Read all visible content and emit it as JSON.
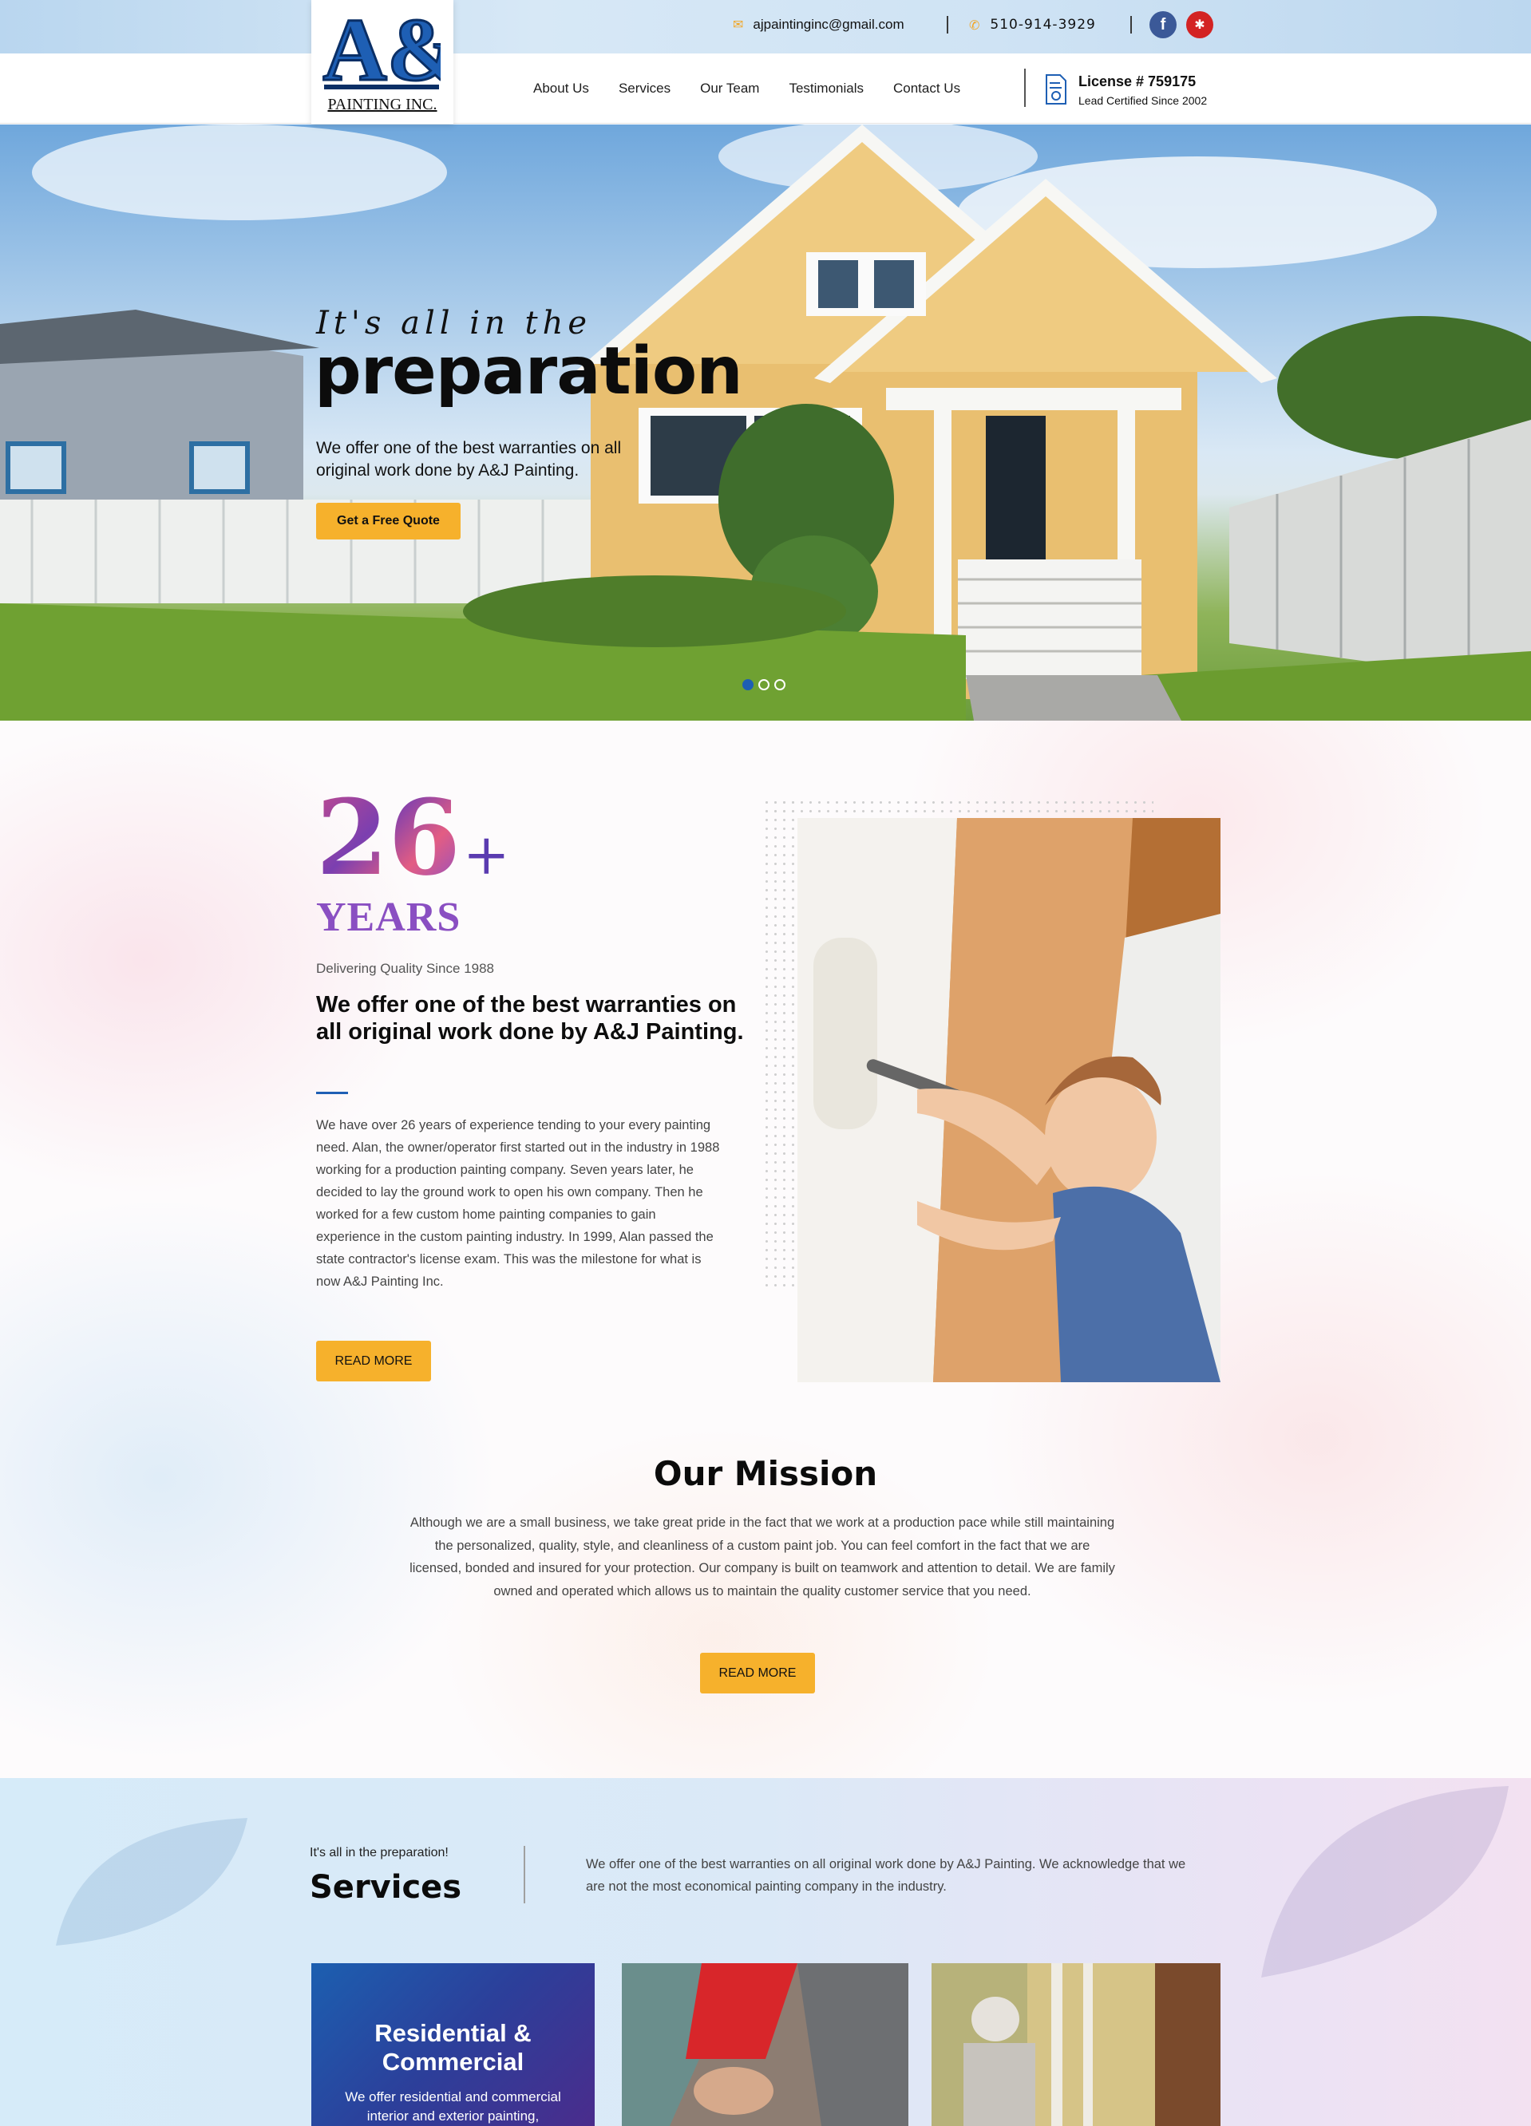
{
  "topbar": {
    "email": "ajpaintinginc@gmail.com",
    "phone": "510-914-3929",
    "social": [
      {
        "name": "facebook",
        "glyph": "f"
      },
      {
        "name": "yelp",
        "glyph": "✱"
      }
    ]
  },
  "logo": {
    "letters": "A&J",
    "subtitle": "PAINTING INC."
  },
  "nav": {
    "items": [
      "About Us",
      "Services",
      "Our Team",
      "Testimonials",
      "Contact Us"
    ],
    "license_title": "License # 759175",
    "license_sub": "Lead Certified Since 2002"
  },
  "hero": {
    "script": "It's all in the",
    "title": "preparation",
    "description": "We offer one of the best warranties on all original work done by A&J Painting.",
    "cta": "Get a Free Quote",
    "slides": 3,
    "active_slide": 1
  },
  "about": {
    "number": "26",
    "plus": "+",
    "years": "YEARS",
    "since": "Delivering Quality Since 1988",
    "heading": "We offer one of the best warranties on all original work done by A&J Painting.",
    "paragraph": "We have over 26 years of experience tending to your every painting need. Alan, the owner/operator first started out in the industry in 1988 working for a production painting company. Seven years later, he decided to lay the ground work to open his own company. Then he worked for a few custom home painting companies to gain experience in the custom painting industry. In 1999, Alan passed the state contractor's license exam. This was the milestone for what is now A&J Painting Inc.",
    "button": "READ MORE"
  },
  "mission": {
    "heading": "Our Mission",
    "paragraph": "Although we are a small business, we take great pride in the fact that we work at a production pace while still maintaining the personalized, quality, style, and cleanliness of a custom paint job. You can feel comfort in the fact that we are licensed, bonded and insured for your protection. Our company is built on teamwork and attention to detail. We are family owned and operated which allows us to maintain the quality customer service that you need.",
    "button": "READ MORE"
  },
  "services": {
    "kicker": "It's all in the preparation!",
    "heading": "Services",
    "description": "We offer one of the best warranties on all original work done by A&J Painting. We acknowledge that we are not the most economical painting company in the industry.",
    "cards": [
      {
        "title": "Residential & Commercial",
        "text": "We offer residential and commercial interior and exterior painting,"
      }
    ]
  },
  "colors": {
    "accent_yellow": "#f6b12c",
    "brand_blue": "#1e5fb4",
    "facebook": "#3b5998",
    "yelp": "#d32323"
  }
}
